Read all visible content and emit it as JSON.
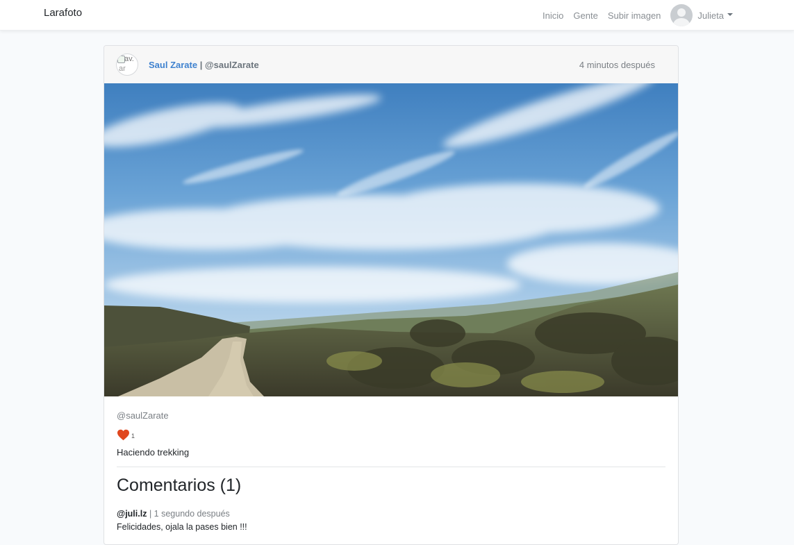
{
  "app": {
    "brand": "Larafoto"
  },
  "nav": {
    "links": [
      "Inicio",
      "Gente",
      "Subir imagen"
    ],
    "user": {
      "name": "Julieta",
      "avatar_icon": "user-avatar-icon"
    }
  },
  "post": {
    "avatar_alt_top": "av.",
    "avatar_alt_bottom": "ar",
    "author_name": "Saul Zarate",
    "separator": "|",
    "author_handle": "@saulZarate",
    "time_ago": "4 minutos después",
    "image_icon": "landscape-photo",
    "handle": "@saulZarate",
    "likes": "1",
    "like_icon": "heart-icon",
    "like_color": "#e0471e",
    "description": "Haciendo trekking"
  },
  "comments": {
    "title": "Comentarios (1)",
    "items": [
      {
        "user": "@juli.lz",
        "separator": "|",
        "time": "1 segundo después",
        "text": "Felicidades, ojala la pases bien !!!"
      }
    ]
  },
  "colors": {
    "link": "#3f82cf",
    "muted": "#7a7f84",
    "background": "#f8fafc"
  }
}
